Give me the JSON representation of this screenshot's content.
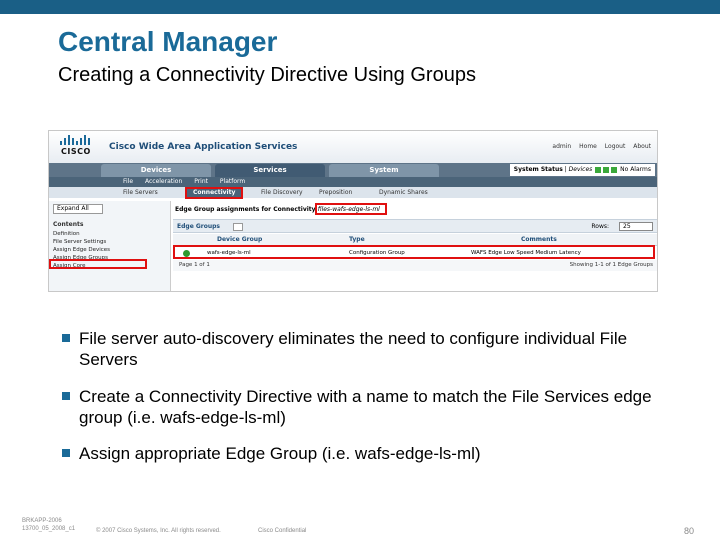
{
  "slide": {
    "title": "Central Manager",
    "subtitle": "Creating a Connectivity Directive Using Groups"
  },
  "screenshot": {
    "logo_text": "CISCO",
    "product": "Cisco Wide Area Application Services",
    "util_links": [
      "admin",
      "Home",
      "Logout",
      "About"
    ],
    "tabs": [
      "Devices",
      "Services",
      "System"
    ],
    "system_status": {
      "label": "System Status",
      "devices": "Devices",
      "alarms": "No Alarms"
    },
    "subnav1": [
      "File",
      "Acceleration",
      "Print",
      "Platform"
    ],
    "subnav2": [
      "File Servers",
      "Connectivity",
      "File Discovery",
      "Preposition",
      "Dynamic Shares"
    ],
    "left": {
      "expand": "Expand All",
      "contents": "Contents",
      "items": [
        "Definition",
        "File Server Settings",
        "Assign Edge Devices",
        "Assign Edge Groups",
        "Assign Core"
      ]
    },
    "panel_title_prefix": "Edge Group assignments for Connectivity",
    "directive_name": "files-wafs-edge-ls-ml",
    "toolbar": {
      "label": "Edge Groups",
      "rows_label": "Rows:",
      "rows_value": "25"
    },
    "columns": [
      "Device Group",
      "Type",
      "Comments"
    ],
    "rows": [
      {
        "device_group": "wafs-edge-ls-ml",
        "type": "Configuration Group",
        "comments": "WAFS Edge Low Speed Medium Latency"
      }
    ],
    "pager_left": "Page 1 of 1",
    "pager_right": "Showing 1-1 of 1 Edge Groups"
  },
  "bullets": [
    "File server auto-discovery eliminates the need to configure individual File Servers",
    "Create a Connectivity Directive with a name to match the File Services edge group (i.e. wafs-edge-ls-ml)",
    "Assign appropriate Edge Group (i.e. wafs-edge-ls-ml)"
  ],
  "footer": {
    "code_line1": "BRKAPP-2006",
    "code_line2": "13700_05_2008_c1",
    "copyright": "© 2007 Cisco Systems, Inc. All rights reserved.",
    "confidential": "Cisco Confidential",
    "page": "80"
  },
  "colors": {
    "accent": "#1a6a98",
    "highlight": "#e01010"
  }
}
